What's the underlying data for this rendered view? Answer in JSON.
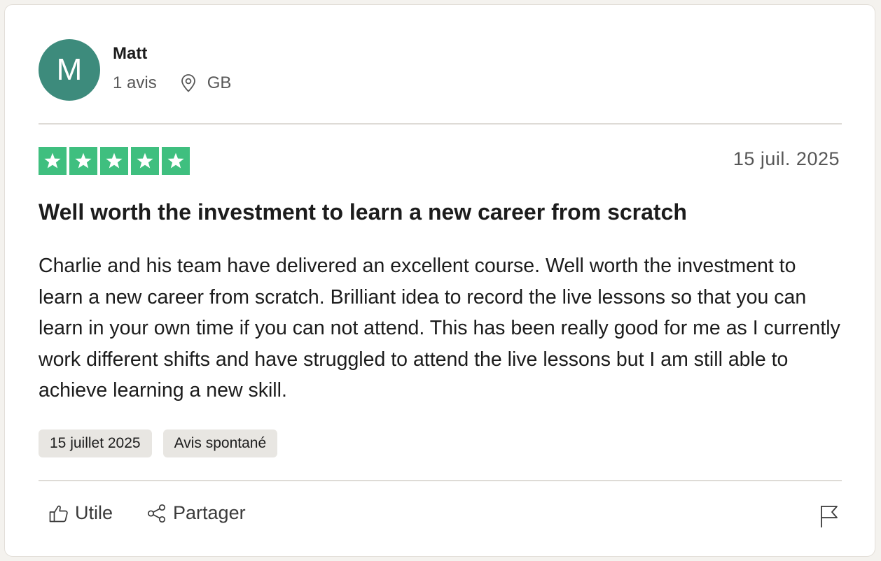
{
  "reviewer": {
    "initial": "M",
    "name": "Matt",
    "review_count": "1 avis",
    "country": "GB",
    "avatar_color": "#3d8b7c"
  },
  "rating": {
    "stars": 5,
    "max": 5,
    "star_color": "#3fbf7f"
  },
  "review": {
    "date": "15 juil. 2025",
    "title": "Well worth the investment to learn a new career from scratch",
    "body": "Charlie and his team have delivered an excellent course. Well worth the investment to learn a new career from scratch. Brilliant idea to record the live lessons so that you can learn in your own time if you can not attend. This has been really good for me as I currently work different shifts and have struggled to attend the live lessons but I am still able to achieve learning a new skill.",
    "tags": [
      "15 juillet 2025",
      "Avis spontané"
    ]
  },
  "actions": {
    "useful_label": "Utile",
    "share_label": "Partager"
  },
  "icons": {
    "location": "location-pin-icon",
    "useful": "thumbs-up-icon",
    "share": "share-icon",
    "report": "flag-icon"
  }
}
